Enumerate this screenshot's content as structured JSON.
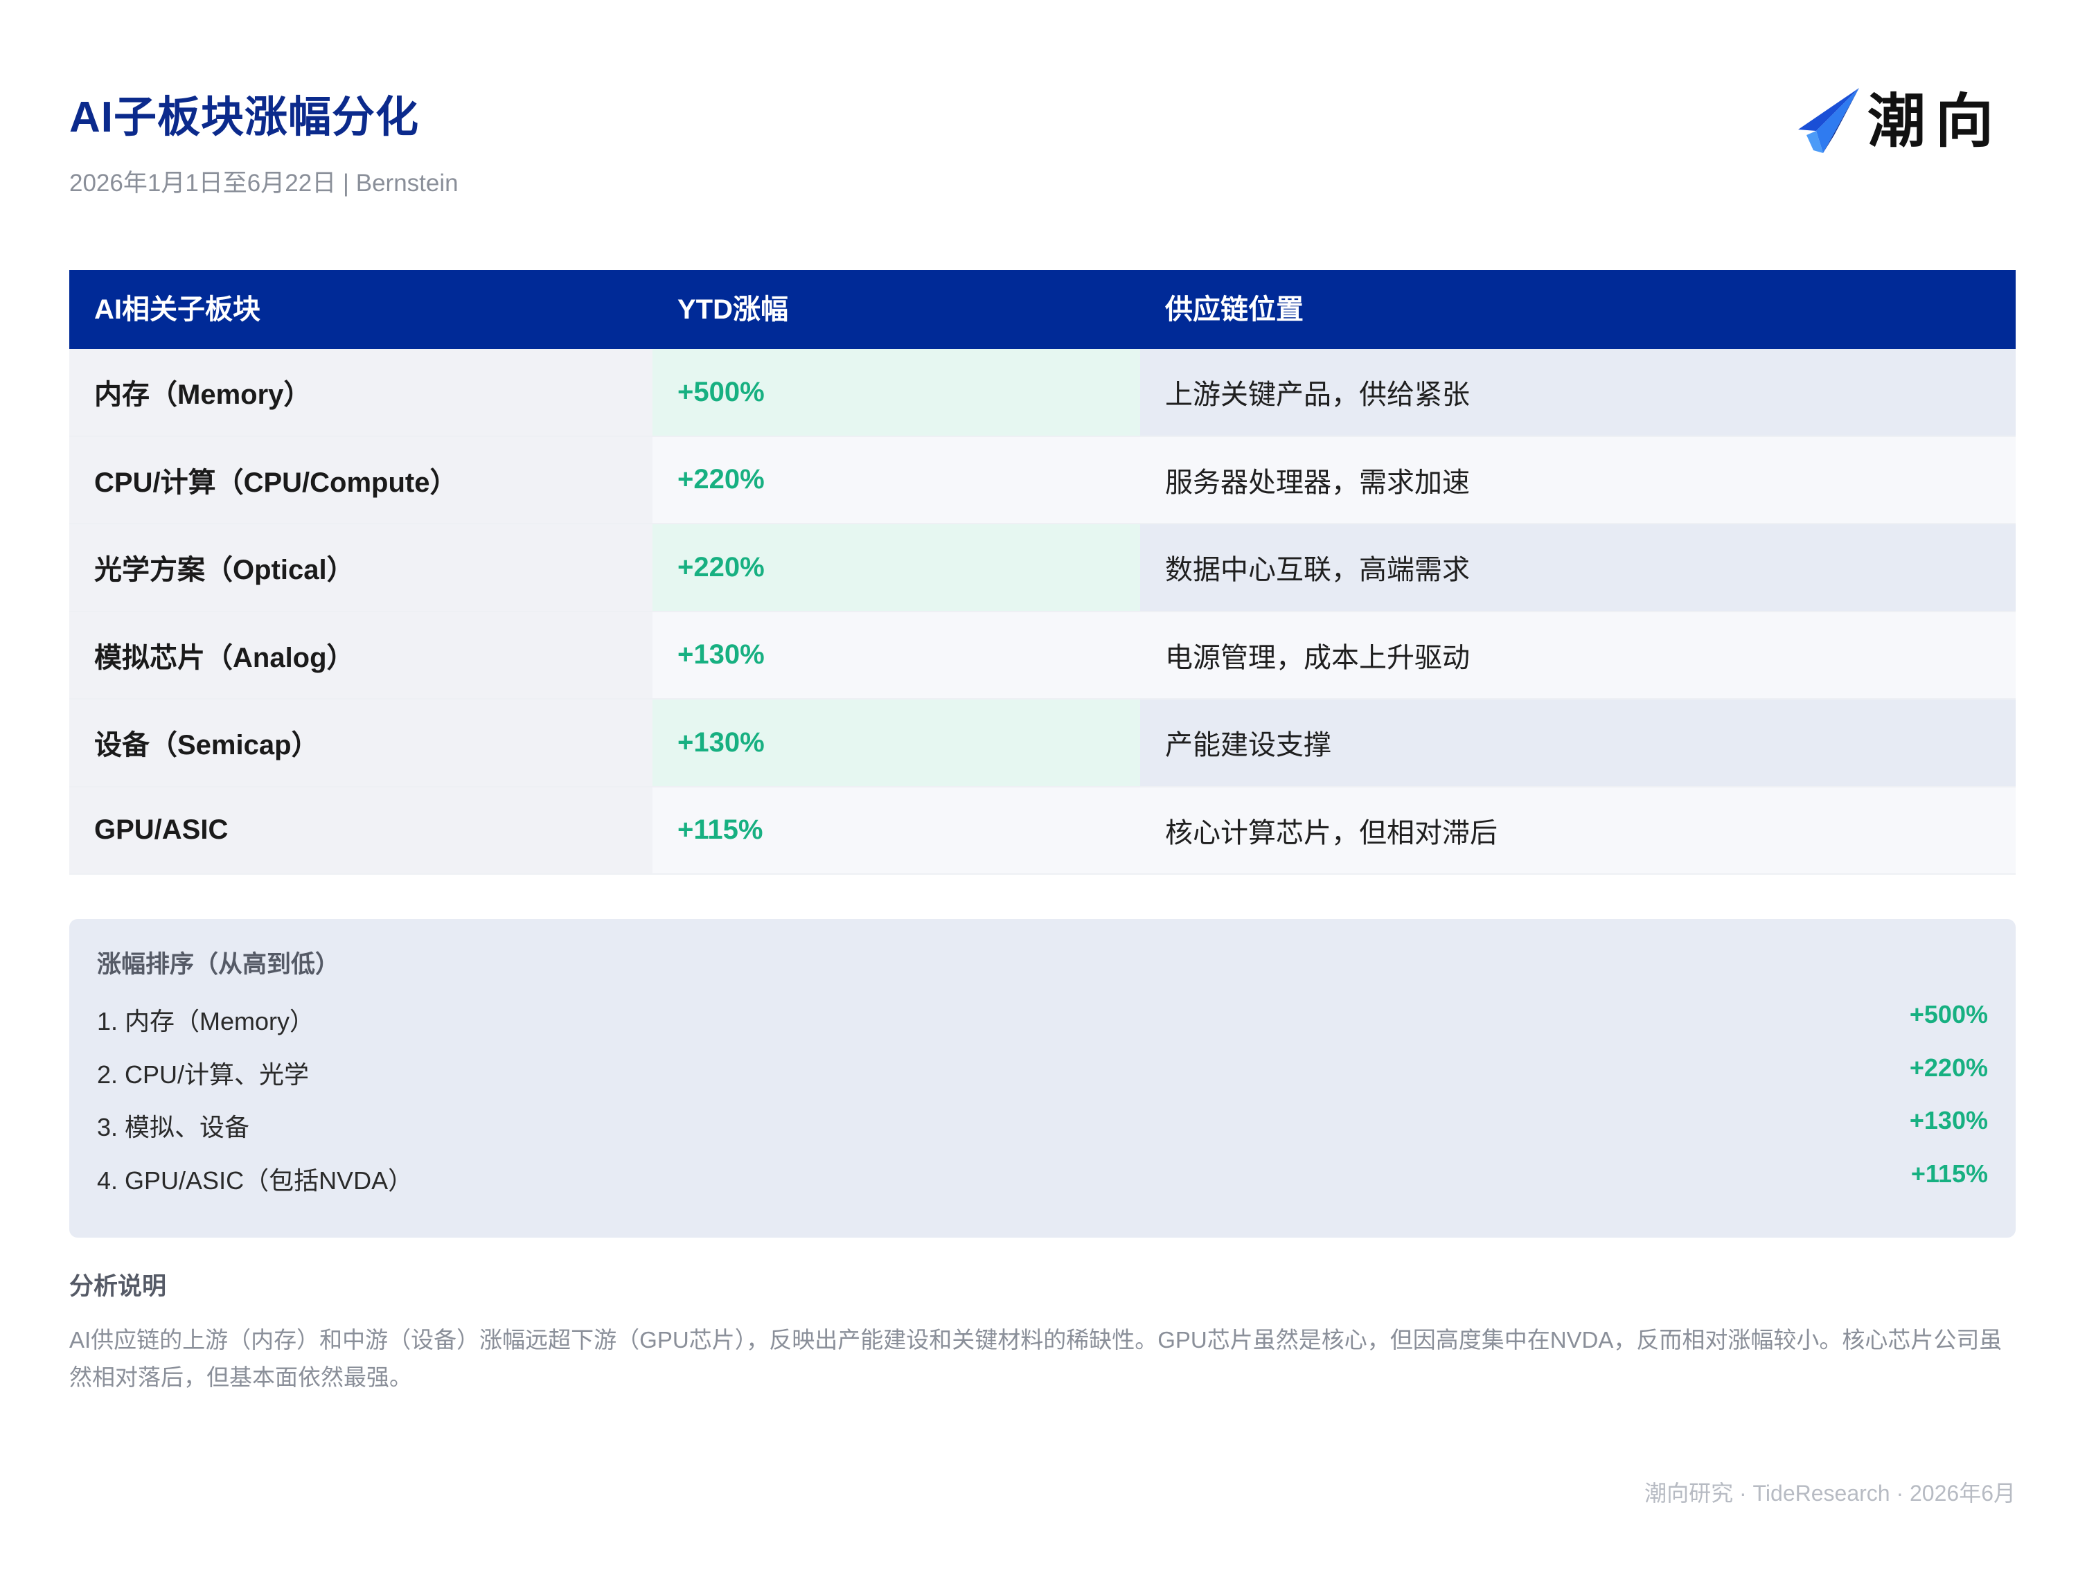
{
  "header": {
    "title": "AI子板块涨幅分化",
    "subtitle": "2026年1月1日至6月22日 | Bernstein",
    "logo_text": "潮向",
    "logo_icon": "paper-plane-icon",
    "accent_color": "#0b2a8c"
  },
  "table": {
    "headers": [
      "AI相关子板块",
      "YTD涨幅",
      "供应链位置"
    ],
    "rows": [
      {
        "sector": "内存（Memory）",
        "ytd": "+500%",
        "position": "上游关键产品，供给紧张"
      },
      {
        "sector": "CPU/计算（CPU/Compute）",
        "ytd": "+220%",
        "position": "服务器处理器，需求加速"
      },
      {
        "sector": "光学方案（Optical）",
        "ytd": "+220%",
        "position": "数据中心互联，高端需求"
      },
      {
        "sector": "模拟芯片（Analog）",
        "ytd": "+130%",
        "position": "电源管理，成本上升驱动"
      },
      {
        "sector": "设备（Semicap）",
        "ytd": "+130%",
        "position": "产能建设支撑"
      },
      {
        "sector": "GPU/ASIC",
        "ytd": "+115%",
        "position": "核心计算芯片，但相对滞后"
      }
    ],
    "header_color": "#002a97",
    "positive_color": "#17b081"
  },
  "ranking": {
    "title": "涨幅排序（从高到低）",
    "items": [
      {
        "label": "1. 内存（Memory）",
        "value": "+500%"
      },
      {
        "label": "2. CPU/计算、光学",
        "value": "+220%"
      },
      {
        "label": "3. 模拟、设备",
        "value": "+130%"
      },
      {
        "label": "4. GPU/ASIC（包括NVDA）",
        "value": "+115%"
      }
    ]
  },
  "notes": {
    "title": "分析说明",
    "body": "AI供应链的上游（内存）和中游（设备）涨幅远超下游（GPU芯片），反映出产能建设和关键材料的稀缺性。GPU芯片虽然是核心，但因高度集中在NVDA，反而相对涨幅较小。核心芯片公司虽然相对落后，但基本面依然最强。"
  },
  "footer": {
    "text": "潮向研究 · TideResearch · 2026年6月"
  }
}
